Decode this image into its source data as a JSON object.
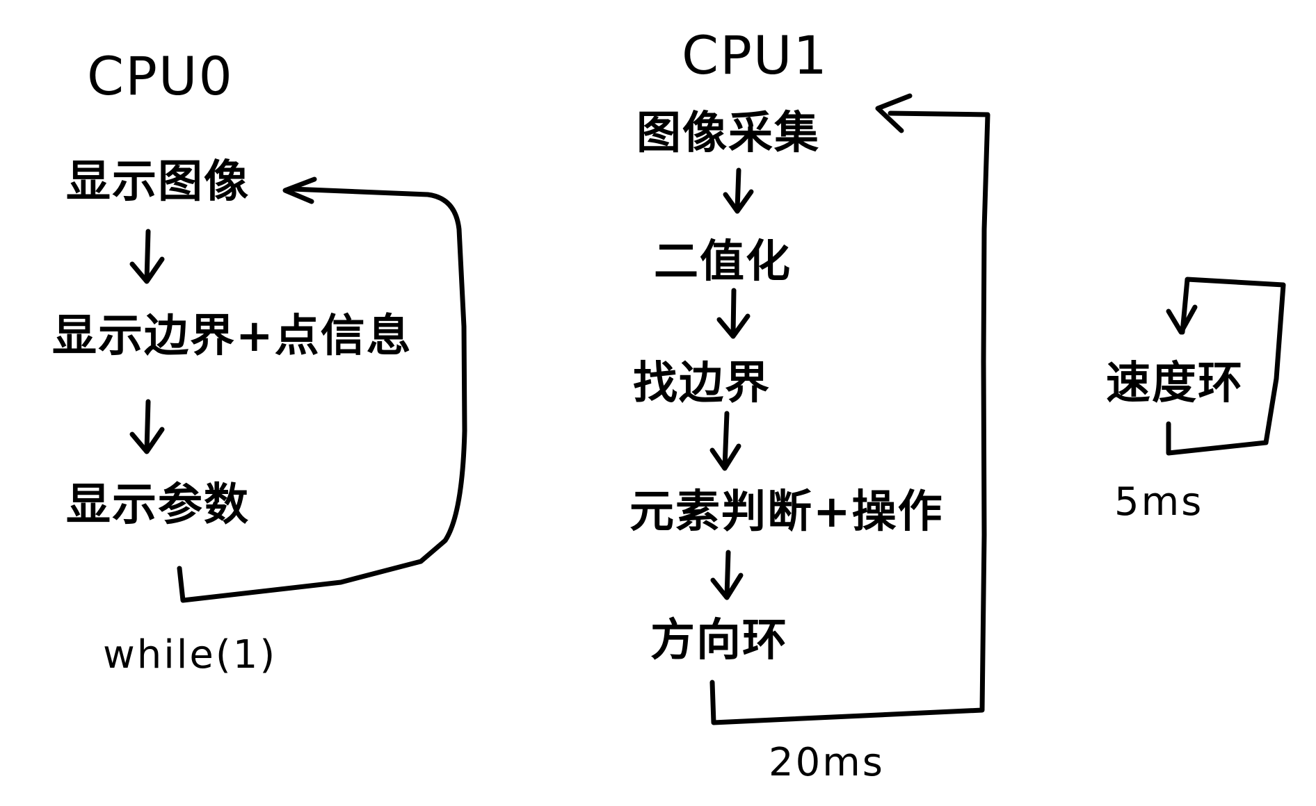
{
  "cpu0": {
    "title": "CPU0",
    "steps": [
      "显示图像",
      "显示边界+点信息",
      "显示参数"
    ],
    "loop_label": "while(1)"
  },
  "cpu1": {
    "title": "CPU1",
    "steps": [
      "图像采集",
      "二值化",
      "找边界",
      "元素判断+操作",
      "方向环"
    ],
    "loop_label": "20ms"
  },
  "speed": {
    "step": "速度环",
    "loop_label": "5ms"
  },
  "colors": {
    "ink": "#000000",
    "paper": "#ffffff"
  }
}
